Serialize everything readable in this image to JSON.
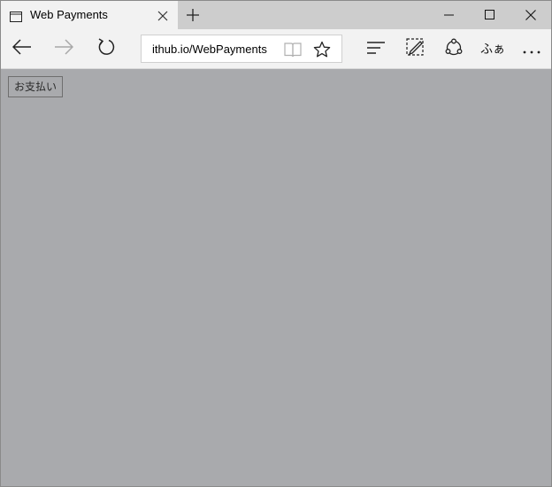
{
  "tab": {
    "title": "Web Payments",
    "icon": "page-icon"
  },
  "window_controls": [
    "minimize-icon",
    "maximize-icon",
    "close-icon"
  ],
  "toolbar": {
    "address": "ithub.io/WebPayments",
    "web_note_label": "ふぁ",
    "icons": [
      "back-icon",
      "forward-icon",
      "refresh-icon",
      "reading-view-icon",
      "favorite-star-icon",
      "hub-icon",
      "web-note-icon",
      "share-icon",
      "more-icon"
    ]
  },
  "page": {
    "pay_button_label": "お支払い",
    "background": "#a9aaad"
  }
}
